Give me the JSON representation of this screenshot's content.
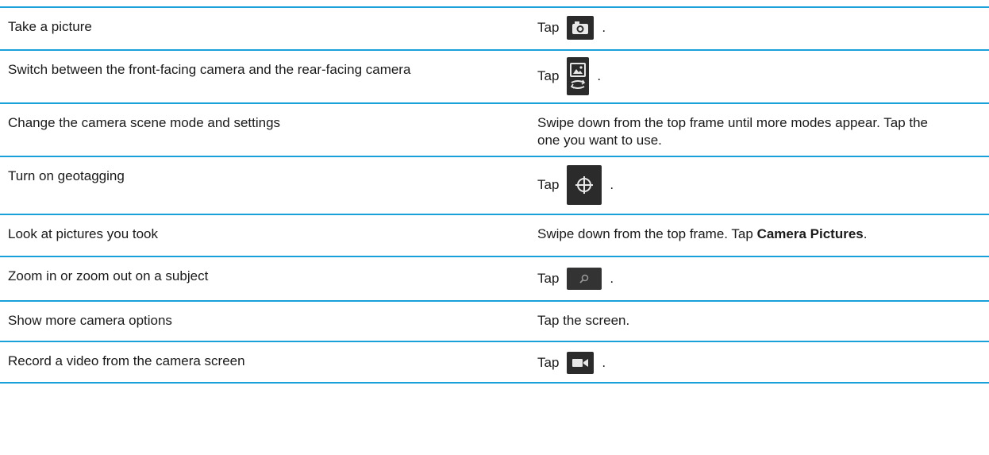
{
  "colors": {
    "rule": "#1aa0d8",
    "text": "#1a1a1a",
    "icon_bg": "#2b2b2b"
  },
  "rows": [
    {
      "task": "Take a picture",
      "prefix": "Tap",
      "icon": "camera-icon",
      "suffix": "."
    },
    {
      "task": "Switch between the front-facing camera and the rear-facing camera",
      "prefix": "Tap",
      "icon": "switch-camera-icon",
      "suffix": "."
    },
    {
      "task": "Change the camera scene mode and settings",
      "result": "Swipe down from the top frame until more modes appear. Tap the one you want to use."
    },
    {
      "task": "Turn on geotagging",
      "prefix": "Tap",
      "icon": "geotagging-crosshair-icon",
      "suffix": "."
    },
    {
      "task": "Look at pictures you took",
      "result_prefix": "Swipe down from the top frame. Tap ",
      "result_bold": "Camera Pictures",
      "result_suffix": "."
    },
    {
      "task": "Zoom in or zoom out on a subject",
      "prefix": "Tap",
      "icon": "zoom-slider-icon",
      "suffix": "."
    },
    {
      "task": "Show more camera options",
      "result": "Tap the screen."
    },
    {
      "task": "Record a video from the camera screen",
      "prefix": "Tap",
      "icon": "video-camera-icon",
      "suffix": "."
    }
  ]
}
